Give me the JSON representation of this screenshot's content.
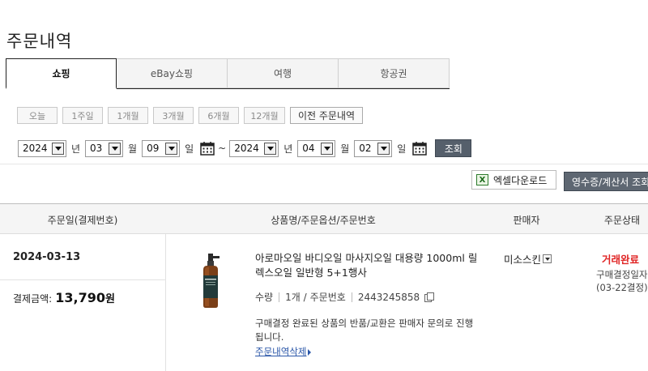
{
  "page": {
    "title": "주문내역"
  },
  "tabs": [
    {
      "label": "쇼핑",
      "active": true
    },
    {
      "label": "eBay쇼핑",
      "active": false
    },
    {
      "label": "여행",
      "active": false
    },
    {
      "label": "항공권",
      "active": false
    }
  ],
  "period": {
    "buttons": [
      "오늘",
      "1주일",
      "1개월",
      "3개월",
      "6개월",
      "12개월"
    ],
    "previous_orders": "이전 주문내역"
  },
  "date_range": {
    "start": {
      "year": "2024",
      "month": "03",
      "day": "09"
    },
    "end": {
      "year": "2024",
      "month": "04",
      "day": "02"
    },
    "unit_year": "년",
    "unit_month": "월",
    "unit_day": "일",
    "tilde": "~",
    "search_label": "조회"
  },
  "actions": {
    "excel_label": "엑셀다운로드",
    "excel_icon_glyph": "X",
    "receipt_label": "영수증/계산서 조회"
  },
  "table": {
    "headers": {
      "order_date": "주문일(결제번호)",
      "product": "상품명/주문옵션/주문번호",
      "seller": "판매자",
      "status": "주문상태"
    }
  },
  "order": {
    "date": "2024-03-13",
    "payment_label": "결제금액:",
    "payment_amount": "13,790",
    "payment_unit": "원",
    "product_name": "아로마오일 바디오일 마사지오일 대용량 1000ml 릴렉스오일 일반형 5+1행사",
    "qty_label": "수량",
    "qty_value": "1개 /",
    "order_no_label": "주문번호",
    "order_no": "2443245858",
    "notice": "구매결정 완료된 상품의 반품/교환은 판매자 문의로 진행됩니다.",
    "delete_label": "주문내역삭제",
    "seller": "미소스킨",
    "status": "거래완료",
    "status_sub_1": "구매결정일자",
    "status_sub_2": "(03-22결정)"
  },
  "colors": {
    "status_red": "#e02424",
    "search_button": "#555f6b",
    "link_blue": "#2a56a8"
  }
}
